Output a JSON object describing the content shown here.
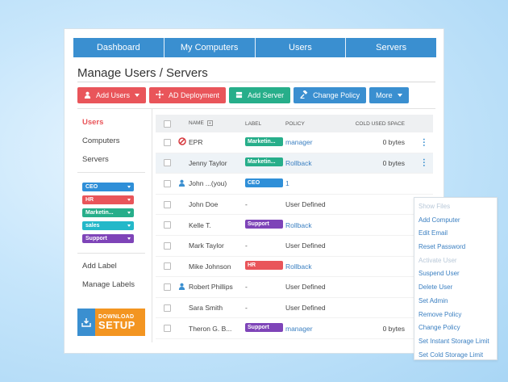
{
  "nav": {
    "items": [
      "Dashboard",
      "My Computers",
      "Users",
      "Servers"
    ]
  },
  "page": {
    "title": "Manage Users / Servers"
  },
  "toolbar": {
    "add_users": "Add Users",
    "ad_deployment": "AD Deployment",
    "add_server": "Add Server",
    "change_policy": "Change Policy",
    "more": "More"
  },
  "sidebar": {
    "links": [
      "Users",
      "Computers",
      "Servers"
    ],
    "tags": [
      {
        "label": "CEO",
        "color": "#2f8fd8"
      },
      {
        "label": "HR",
        "color": "#e9555a"
      },
      {
        "label": "Marketin...",
        "color": "#27ae8a"
      },
      {
        "label": "sales",
        "color": "#23b8c9"
      },
      {
        "label": "Support",
        "color": "#7e44b8"
      }
    ],
    "add_label": "Add Label",
    "manage_labels": "Manage Labels"
  },
  "download": {
    "line1": "DOWNLOAD",
    "line2": "SETUP"
  },
  "table": {
    "headers": {
      "name": "NAME",
      "label": "LABEL",
      "policy": "POLICY",
      "space": "COLD USED SPACE"
    },
    "rows": [
      {
        "name": "EPR",
        "icon": "blocked",
        "label": "Marketin...",
        "label_color": "#27ae8a",
        "policy": "manager",
        "policy_link": true,
        "space": "0 bytes"
      },
      {
        "name": "Jenny Taylor",
        "icon": "",
        "label": "Marketin...",
        "label_color": "#27ae8a",
        "policy": "Rollback",
        "policy_link": true,
        "space": "0 bytes"
      },
      {
        "name": "John ...(you)",
        "icon": "user",
        "label": "CEO",
        "label_color": "#2f8fd8",
        "policy": "1",
        "policy_link": true,
        "space": ""
      },
      {
        "name": "John Doe",
        "icon": "",
        "label": "-",
        "label_color": "",
        "policy": "User Defined",
        "policy_link": false,
        "space": ""
      },
      {
        "name": "Kelle T.",
        "icon": "",
        "label": "Support",
        "label_color": "#7e44b8",
        "policy": "Rollback",
        "policy_link": true,
        "space": ""
      },
      {
        "name": "Mark Taylor",
        "icon": "",
        "label": "-",
        "label_color": "",
        "policy": "User Defined",
        "policy_link": false,
        "space": ""
      },
      {
        "name": "Mike Johnson",
        "icon": "",
        "label": "HR",
        "label_color": "#e9555a",
        "policy": "Rollback",
        "policy_link": true,
        "space": ""
      },
      {
        "name": "Robert Phillips",
        "icon": "user",
        "label": "-",
        "label_color": "",
        "policy": "User Defined",
        "policy_link": false,
        "space": ""
      },
      {
        "name": "Sara Smith",
        "icon": "",
        "label": "-",
        "label_color": "",
        "policy": "User Defined",
        "policy_link": false,
        "space": ""
      },
      {
        "name": "Theron G. B...",
        "icon": "",
        "label": "Support",
        "label_color": "#7e44b8",
        "policy": "manager",
        "policy_link": true,
        "space": "0 bytes"
      }
    ]
  },
  "dropdown": {
    "items": [
      {
        "label": "Show Files",
        "disabled": true
      },
      {
        "label": "Add Computer",
        "disabled": false
      },
      {
        "label": "Edit Email",
        "disabled": false
      },
      {
        "label": "Reset Password",
        "disabled": false
      },
      {
        "label": "Activate User",
        "disabled": true
      },
      {
        "label": "Suspend User",
        "disabled": false
      },
      {
        "label": "Delete User",
        "disabled": false
      },
      {
        "label": "Set Admin",
        "disabled": false
      },
      {
        "label": "Remove Policy",
        "disabled": false
      },
      {
        "label": "Change Policy",
        "disabled": false
      },
      {
        "label": "Set Instant Storage Limit",
        "disabled": false
      },
      {
        "label": "Set Cold Storage Limit",
        "disabled": false
      }
    ]
  }
}
